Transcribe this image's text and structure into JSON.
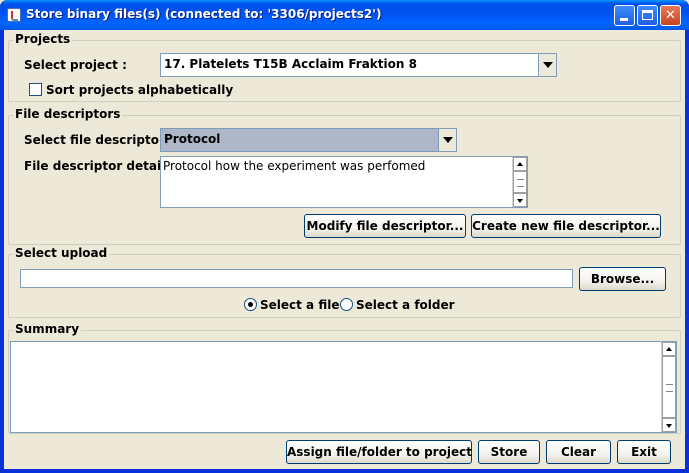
{
  "window": {
    "title": "Store binary files(s) (connected to: '3306/projects2')"
  },
  "projects": {
    "group_title": "Projects",
    "select_label": "Select project :",
    "selected_project": "17. Platelets T15B Acclaim Fraktion 8",
    "sort_label": "Sort projects alphabetically",
    "sort_checked": false
  },
  "file_descriptors": {
    "group_title": "File descriptors",
    "select_label": "Select file descriptor :",
    "selected_descriptor": "Protocol",
    "details_label": "File descriptor details :",
    "details_text": "Protocol how the experiment was perfomed",
    "modify_button": "Modify file descriptor...",
    "create_button": "Create new file descriptor..."
  },
  "upload": {
    "group_title": "Select upload",
    "path_value": "",
    "browse_button": "Browse...",
    "option_file": "Select a file",
    "option_folder": "Select a folder",
    "selected_option": "file"
  },
  "summary": {
    "group_title": "Summary",
    "text": ""
  },
  "actions": {
    "assign_button": "Assign file/folder to project",
    "store_button": "Store",
    "clear_button": "Clear",
    "exit_button": "Exit"
  },
  "icons": {
    "app": "java-cup-icon",
    "minimize": "minimize-icon",
    "maximize": "maximize-icon",
    "close": "close-icon"
  }
}
